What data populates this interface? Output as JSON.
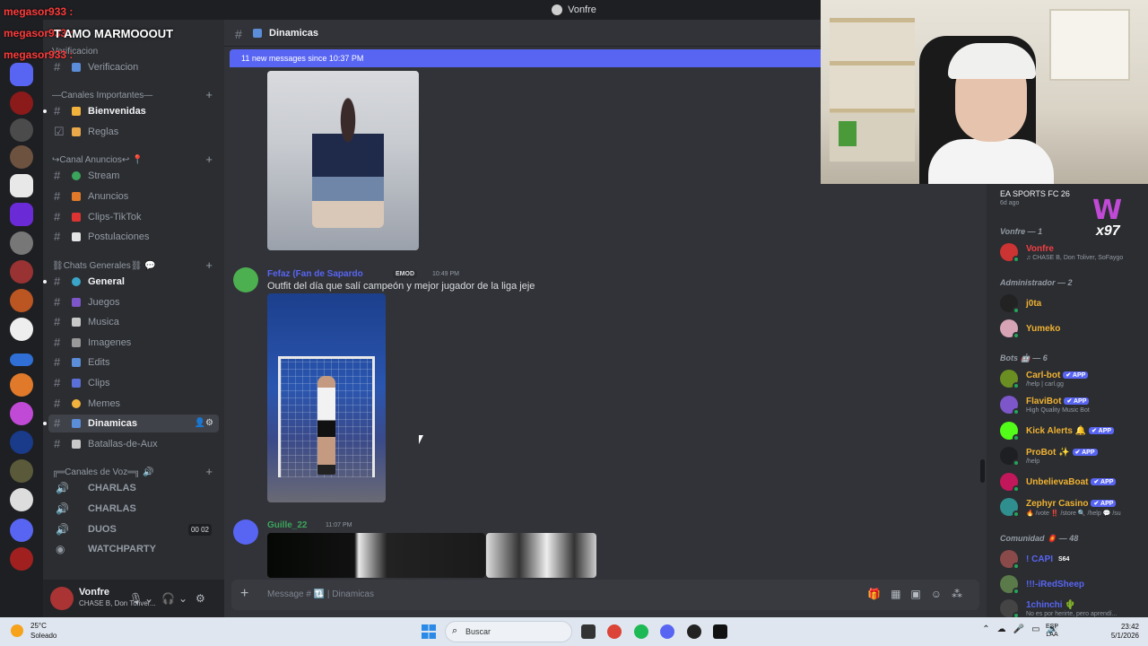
{
  "window_title": "Vonfre",
  "overlay": {
    "lines": [
      "megasor933 :",
      "megasor933 :",
      "megasor933 :"
    ],
    "chat_message": "T AMO MARMOOOUT"
  },
  "sidebar": {
    "partial_category": "Verificacion",
    "categories": [
      {
        "label": "—Canales Importantes—"
      },
      {
        "label": "↪Canal Anuncios↩ 📍"
      },
      {
        "label": "⛓Chats Generales⛓ 💬"
      },
      {
        "label": "╔═Canales de Voz═╗ 🔊"
      }
    ],
    "channels": [
      {
        "label": "Verificacion"
      },
      {
        "label": "Bienvenidas"
      },
      {
        "label": "Reglas"
      },
      {
        "label": "Stream"
      },
      {
        "label": "Anuncios"
      },
      {
        "label": "Clips-TikTok"
      },
      {
        "label": "Postulaciones"
      },
      {
        "label": "General"
      },
      {
        "label": "Juegos"
      },
      {
        "label": "Musica"
      },
      {
        "label": "Imagenes"
      },
      {
        "label": "Edits"
      },
      {
        "label": "Clips"
      },
      {
        "label": "Memes"
      },
      {
        "label": "Dinamicas"
      },
      {
        "label": "Batallas-de-Aux"
      }
    ],
    "voice": [
      {
        "label": "CHARLAS"
      },
      {
        "label": "CHARLAS"
      },
      {
        "label": "DUOS",
        "count_a": "00",
        "count_b": "02"
      },
      {
        "label": "WATCHPARTY"
      }
    ]
  },
  "user": {
    "name": "Vonfre",
    "status": "CHASE B, Don Toliver..."
  },
  "channel_header": {
    "name": "Dinamicas"
  },
  "new_messages_banner": "11 new messages since 10:37 PM",
  "messages": [
    {
      "author": "Fefaz (Fan de Sapardo",
      "tag": "EMOD",
      "time": "10:49 PM",
      "text": "Outfit del día que salí campeón y mejor jugador de la liga jeje"
    },
    {
      "author": "Guille_22",
      "time": "11:07 PM"
    }
  ],
  "composer": {
    "placeholder": "Message # 🔃 | Dinamicas"
  },
  "members": {
    "activity_title": "EA SPORTS FC 26",
    "activity_time": "6d ago",
    "logo_letter": "W",
    "logo_text": "x97",
    "groups": [
      {
        "label": "Vonfre — 1"
      },
      {
        "label": "Administrador — 2"
      },
      {
        "label": "Bots 🤖 — 6"
      },
      {
        "label": "Comunidad 🏮 — 48"
      }
    ],
    "list": [
      {
        "name": "Vonfre",
        "sub": "♫ CHASE B, Don Toliver, SoFaygo",
        "color": "#f23f43"
      },
      {
        "name": "j0ta",
        "sub": "",
        "color": "#f0b232"
      },
      {
        "name": "Yumeko",
        "sub": "",
        "color": "#f0b232"
      },
      {
        "name": "Carl-bot",
        "sub": "/help | carl.gg",
        "color": "#f0b232",
        "app": "✔ APP"
      },
      {
        "name": "FlaviBot",
        "sub": "High Quality Music Bot",
        "color": "#f0b232",
        "app": "✔ APP"
      },
      {
        "name": "Kick Alerts 🔔",
        "sub": "",
        "color": "#f0b232",
        "app": "✔ APP"
      },
      {
        "name": "ProBot ✨",
        "sub": "/help",
        "color": "#f0b232",
        "app": "✔ APP"
      },
      {
        "name": "UnbelievaBoat",
        "sub": "",
        "color": "#f0b232",
        "app": "✔ APP"
      },
      {
        "name": "Zephyr Casino",
        "sub": "🔥 /vote ‼️ /store 🔍 /help 💬 /su",
        "color": "#f0b232",
        "app": "✔ APP"
      },
      {
        "name": "! CAPI",
        "sub": "",
        "color": "#5865f2",
        "badge": "S64"
      },
      {
        "name": "!!!-iRedSheep",
        "sub": "",
        "color": "#5865f2"
      },
      {
        "name": "1chinchi 🌵",
        "sub": "No es por herirte, pero aprendí...",
        "color": "#5865f2"
      }
    ]
  },
  "taskbar": {
    "temp": "25°C",
    "weather": "Soleado",
    "search": "Buscar",
    "lang1": "ESP",
    "lang2": "LAA",
    "time": "23:42",
    "date": "5/1/2026"
  }
}
